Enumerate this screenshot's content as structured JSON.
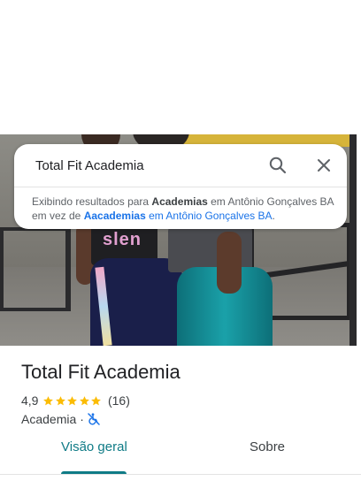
{
  "search": {
    "query": "Total Fit Academia"
  },
  "result_note": {
    "prefix": "Exibindo resultados para ",
    "shown_term": "Academias",
    "shown_location": " em Antônio Gonçalves BA",
    "middle": " em vez de ",
    "alt_term": "Aacademias",
    "alt_location": " em Antônio Gonçalves BA",
    "suffix": "."
  },
  "place": {
    "title": "Total Fit Academia",
    "rating": "4,9",
    "stars": 5,
    "star_color": "#fbbc04",
    "review_count": "(16)",
    "category": "Academia",
    "separator": "·",
    "accessibility_icon": "no-wheelchair-access-icon",
    "accessibility_color": "#1a73e8"
  },
  "tabs": [
    {
      "label": "Visão geral",
      "active": true
    },
    {
      "label": "Sobre",
      "active": false
    }
  ],
  "hero_text": "slen"
}
